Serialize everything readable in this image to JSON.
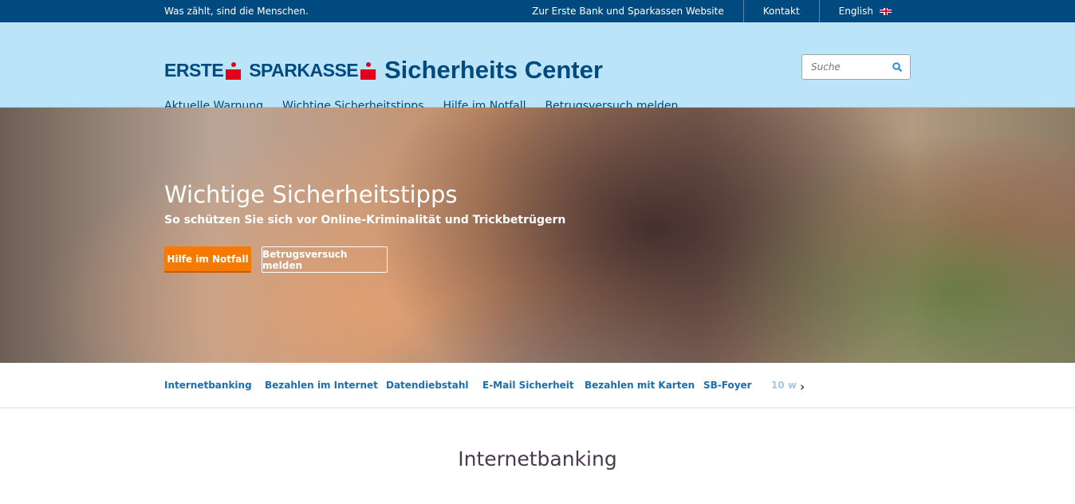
{
  "topbar": {
    "slogan": "Was zählt, sind die Menschen.",
    "links": [
      "Zur Erste Bank und Sparkassen Website",
      "Kontakt",
      "English"
    ]
  },
  "header": {
    "logo": "ERSTE SPARKASSE",
    "logo_parts": [
      "ERSTE",
      "SPARKASSE"
    ],
    "title": "Sicherheits Center",
    "search_placeholder": "Suche",
    "nav": [
      "Aktuelle Warnung",
      "Wichtige Sicherheitstipps",
      "Hilfe im Notfall",
      "Betrugsversuch melden"
    ]
  },
  "hero": {
    "title": "Wichtige Sicherheitstipps",
    "subtitle": "So schützen Sie sich vor Online-Kriminalität und Trickbetrügern",
    "primary": "Hilfe im Notfall",
    "secondary": "Betrugsversuch melden"
  },
  "tabs": [
    "Internetbanking",
    "Bezahlen im Internet",
    "Datendiebstahl",
    "E-Mail Sicherheit",
    "Bezahlen mit Karten",
    "SB-Foyer",
    "10 w"
  ],
  "section": {
    "title": "Internetbanking"
  },
  "colors": {
    "topbar": "#004a7f",
    "header": "#bce4f8",
    "accent": "#f77a00",
    "logo_red": "#e2001a"
  }
}
